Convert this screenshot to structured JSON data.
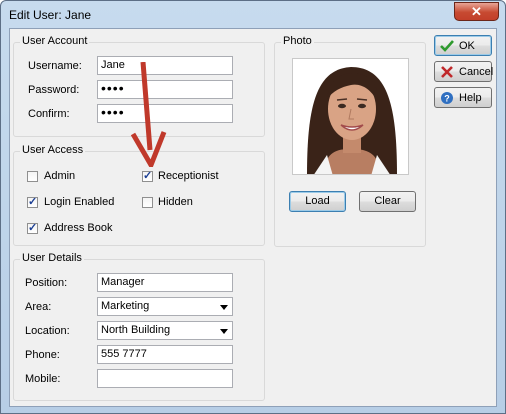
{
  "window": {
    "title": "Edit User: Jane",
    "close_glyph": "✕"
  },
  "user_account": {
    "title": "User Account",
    "username_label": "Username:",
    "username_value": "Jane",
    "password_label": "Password:",
    "password_value": "••••",
    "confirm_label": "Confirm:",
    "confirm_value": "••••"
  },
  "user_access": {
    "title": "User Access",
    "admin": {
      "label": "Admin",
      "checked": false
    },
    "receptionist": {
      "label": "Receptionist",
      "checked": true
    },
    "login_enabled": {
      "label": "Login Enabled",
      "checked": true
    },
    "hidden": {
      "label": "Hidden",
      "checked": false
    },
    "address_book": {
      "label": "Address Book",
      "checked": true
    }
  },
  "user_details": {
    "title": "User Details",
    "position_label": "Position:",
    "position_value": "Manager",
    "area_label": "Area:",
    "area_value": "Marketing",
    "location_label": "Location:",
    "location_value": "North Building",
    "phone_label": "Phone:",
    "phone_value": "555 7777",
    "mobile_label": "Mobile:",
    "mobile_value": ""
  },
  "photo": {
    "title": "Photo",
    "load_label": "Load",
    "clear_label": "Clear"
  },
  "side_buttons": {
    "ok_label": "OK",
    "cancel_label": "Cancel",
    "help_label": "Help"
  },
  "check_glyph": "✓",
  "colors": {
    "annotation_arrow": "#c0392b",
    "ok_check": "#2e9a2e",
    "cancel_x": "#c0282a",
    "help_icon": "#2f6fc1"
  },
  "icons": {
    "ok": "check-icon",
    "cancel": "x-icon",
    "help": "help-icon",
    "annotation": "red-arrow-annotation"
  }
}
